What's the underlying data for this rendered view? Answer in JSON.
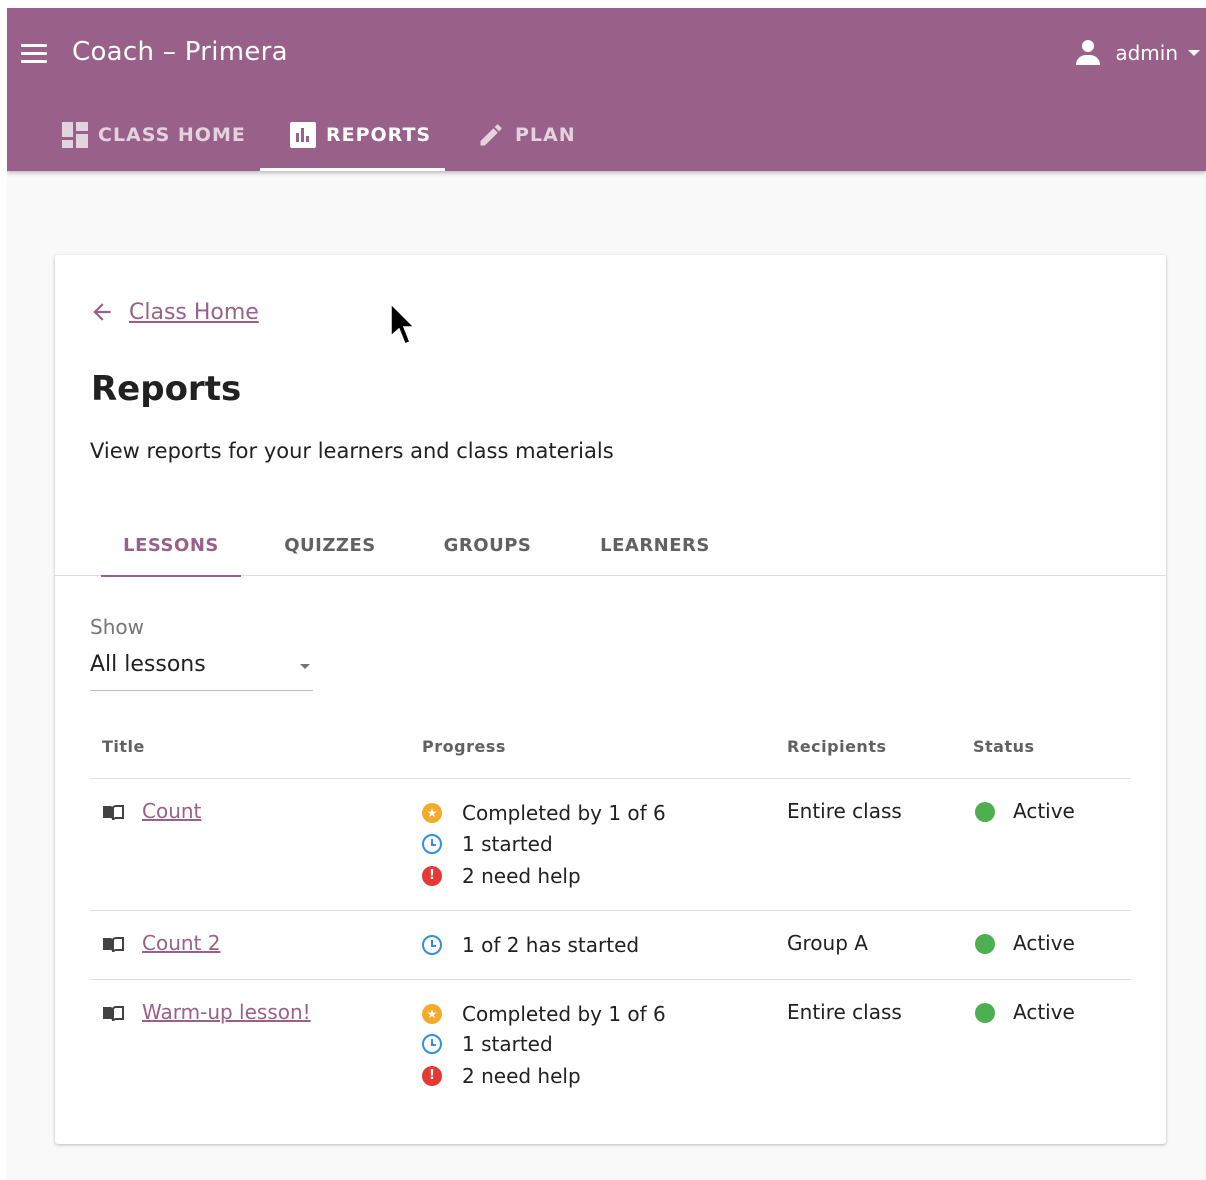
{
  "appbar": {
    "title": "Coach – Primera",
    "user": "admin",
    "tabs": [
      {
        "label": "CLASS HOME",
        "icon": "dashboard-icon"
      },
      {
        "label": "REPORTS",
        "icon": "bar-chart-icon"
      },
      {
        "label": "PLAN",
        "icon": "pencil-icon"
      }
    ],
    "active_tab": "REPORTS"
  },
  "page": {
    "back_label": "Class Home",
    "title": "Reports",
    "description": "View reports for your learners and class materials",
    "tabs": [
      "LESSONS",
      "QUIZZES",
      "GROUPS",
      "LEARNERS"
    ],
    "active_tab": "LESSONS"
  },
  "filter": {
    "label": "Show",
    "value": "All lessons"
  },
  "table": {
    "headers": [
      "Title",
      "Progress",
      "Recipients",
      "Status"
    ],
    "rows": [
      {
        "title": "Count",
        "progress": [
          {
            "icon": "star-icon",
            "text": "Completed by 1 of 6"
          },
          {
            "icon": "clock-icon",
            "text": "1 started"
          },
          {
            "icon": "help-icon",
            "text": "2 need help"
          }
        ],
        "recipients": "Entire class",
        "status": "Active"
      },
      {
        "title": "Count 2",
        "progress": [
          {
            "icon": "clock-icon",
            "text": "1 of 2 has started"
          }
        ],
        "recipients": "Group A",
        "status": "Active"
      },
      {
        "title": "Warm-up lesson!",
        "progress": [
          {
            "icon": "star-icon",
            "text": "Completed by 1 of 6"
          },
          {
            "icon": "clock-icon",
            "text": "1 started"
          },
          {
            "icon": "help-icon",
            "text": "2 need help"
          }
        ],
        "recipients": "Entire class",
        "status": "Active"
      }
    ]
  },
  "colors": {
    "brand": "#996189",
    "active_status": "#4caf50",
    "completed": "#f3ab2b",
    "started": "#2f8fe4",
    "need_help": "#e53935"
  }
}
